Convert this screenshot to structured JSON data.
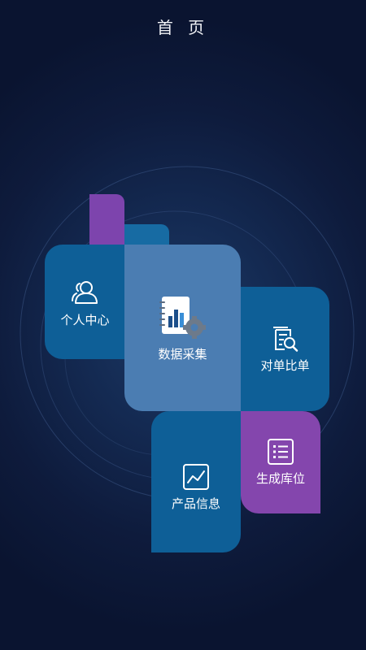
{
  "header": {
    "title": "首 页"
  },
  "tiles": {
    "personal": {
      "label": "个人中心",
      "icon": "person-icon"
    },
    "collect": {
      "label": "数据采集",
      "icon": "report-gear-icon"
    },
    "compare": {
      "label": "对单比单",
      "icon": "document-search-icon"
    },
    "product": {
      "label": "产品信息",
      "icon": "line-chart-icon"
    },
    "location": {
      "label": "生成库位",
      "icon": "list-icon"
    }
  },
  "colors": {
    "tile_blue": "#0e5f97",
    "tile_light_blue": "#4b7db2",
    "tile_purple": "#8446ad",
    "background": "#0e1b3c"
  }
}
